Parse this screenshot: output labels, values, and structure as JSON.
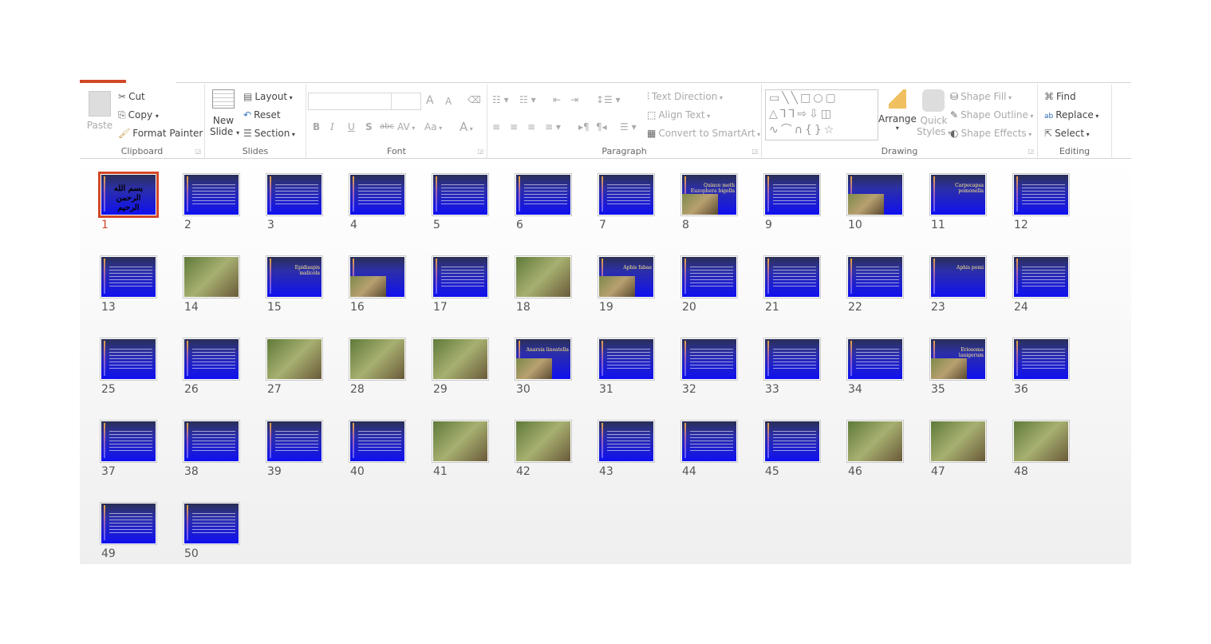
{
  "ribbon": {
    "clipboard": {
      "label": "Clipboard",
      "paste": "Paste",
      "cut": "Cut",
      "copy": "Copy",
      "format_painter": "Format Painter"
    },
    "slides": {
      "label": "Slides",
      "new_slide_1": "New",
      "new_slide_2": "Slide",
      "layout": "Layout",
      "reset": "Reset",
      "section": "Section"
    },
    "font": {
      "label": "Font",
      "font_name": "",
      "font_size": "",
      "bold": "B",
      "italic": "I",
      "underline": "U",
      "shadow": "S",
      "strike": "abc",
      "spacing": "AV",
      "case": "Aa",
      "color": "A",
      "grow": "A",
      "shrink": "A"
    },
    "paragraph": {
      "label": "Paragraph",
      "text_direction": "Text Direction",
      "align_text": "Align Text",
      "convert_smartart": "Convert to SmartArt"
    },
    "drawing": {
      "label": "Drawing",
      "arrange": "Arrange",
      "quick_styles_1": "Quick",
      "quick_styles_2": "Styles",
      "shape_fill": "Shape Fill",
      "shape_outline": "Shape Outline",
      "shape_effects": "Shape Effects"
    },
    "editing": {
      "label": "Editing",
      "find": "Find",
      "replace": "Replace",
      "select": "Select"
    }
  },
  "accent": "#d24726",
  "selected_slide": 1,
  "slides": [
    {
      "n": "1",
      "caption": "بسم الله الرحمن الرحیم",
      "kind": "title"
    },
    {
      "n": "2",
      "kind": "text"
    },
    {
      "n": "3",
      "kind": "text"
    },
    {
      "n": "4",
      "kind": "text"
    },
    {
      "n": "5",
      "kind": "text"
    },
    {
      "n": "6",
      "kind": "text"
    },
    {
      "n": "7",
      "kind": "text"
    },
    {
      "n": "8",
      "caption": "Quince moth Euzophera bigella",
      "kind": "partial"
    },
    {
      "n": "9",
      "kind": "text"
    },
    {
      "n": "10",
      "kind": "partial"
    },
    {
      "n": "11",
      "caption": "Carpocapsa pomonella",
      "kind": "title"
    },
    {
      "n": "12",
      "kind": "text"
    },
    {
      "n": "13",
      "kind": "text"
    },
    {
      "n": "14",
      "kind": "photo"
    },
    {
      "n": "15",
      "caption": "Epidiaspis malicola",
      "kind": "title"
    },
    {
      "n": "16",
      "kind": "partial"
    },
    {
      "n": "17",
      "kind": "text"
    },
    {
      "n": "18",
      "kind": "photo"
    },
    {
      "n": "19",
      "caption": "Aphis fabae",
      "kind": "partial"
    },
    {
      "n": "20",
      "kind": "text"
    },
    {
      "n": "21",
      "kind": "text"
    },
    {
      "n": "22",
      "kind": "text"
    },
    {
      "n": "23",
      "caption": "Aphis pomi",
      "kind": "title"
    },
    {
      "n": "24",
      "kind": "text"
    },
    {
      "n": "25",
      "kind": "text"
    },
    {
      "n": "26",
      "kind": "text"
    },
    {
      "n": "27",
      "kind": "photo"
    },
    {
      "n": "28",
      "kind": "photo"
    },
    {
      "n": "29",
      "kind": "photo"
    },
    {
      "n": "30",
      "caption": "Anarsia lineatella",
      "kind": "partial"
    },
    {
      "n": "31",
      "kind": "text"
    },
    {
      "n": "32",
      "kind": "text"
    },
    {
      "n": "33",
      "kind": "text"
    },
    {
      "n": "34",
      "kind": "text"
    },
    {
      "n": "35",
      "caption": "Eriosoma lanigerum",
      "kind": "partial"
    },
    {
      "n": "36",
      "kind": "text"
    },
    {
      "n": "37",
      "kind": "text"
    },
    {
      "n": "38",
      "kind": "text"
    },
    {
      "n": "39",
      "kind": "text"
    },
    {
      "n": "40",
      "kind": "text"
    },
    {
      "n": "41",
      "kind": "photo"
    },
    {
      "n": "42",
      "kind": "photo"
    },
    {
      "n": "43",
      "kind": "text"
    },
    {
      "n": "44",
      "kind": "text"
    },
    {
      "n": "45",
      "kind": "text"
    },
    {
      "n": "46",
      "kind": "photo"
    },
    {
      "n": "47",
      "kind": "photo"
    },
    {
      "n": "48",
      "kind": "photo"
    },
    {
      "n": "49",
      "kind": "text"
    },
    {
      "n": "50",
      "kind": "text"
    }
  ]
}
